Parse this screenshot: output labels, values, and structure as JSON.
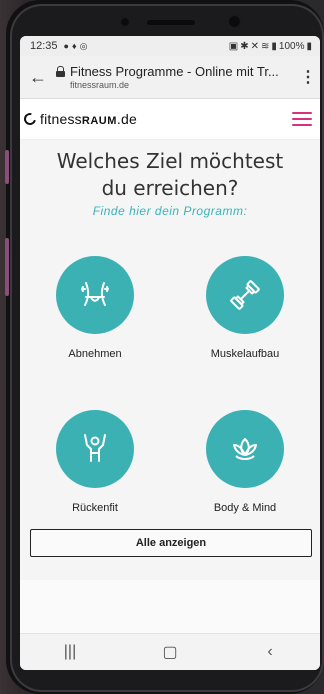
{
  "status_bar": {
    "time": "12:35",
    "battery": "100%"
  },
  "browser": {
    "page_title": "Fitness Programme - Online mit Tr...",
    "domain": "fitnessraum.de"
  },
  "site": {
    "logo_prefix": "fitness",
    "logo_bold": "RAUM",
    "logo_suffix": ".de",
    "accent_color": "#3bb1b4",
    "menu_color": "#d6337f"
  },
  "main": {
    "headline": "Welches Ziel möchtest du erreichen?",
    "subheadline": "Finde hier dein Programm:",
    "goals": [
      {
        "label": "Abnehmen",
        "icon": "waist-icon"
      },
      {
        "label": "Muskelaufbau",
        "icon": "dumbbell-icon"
      },
      {
        "label": "Rückenfit",
        "icon": "back-person-icon"
      },
      {
        "label": "Body & Mind",
        "icon": "lotus-icon"
      }
    ],
    "show_all_label": "Alle anzeigen"
  },
  "nav": {
    "recents_icon": "recents-icon",
    "home_icon": "home-icon",
    "back_icon": "back-icon"
  }
}
